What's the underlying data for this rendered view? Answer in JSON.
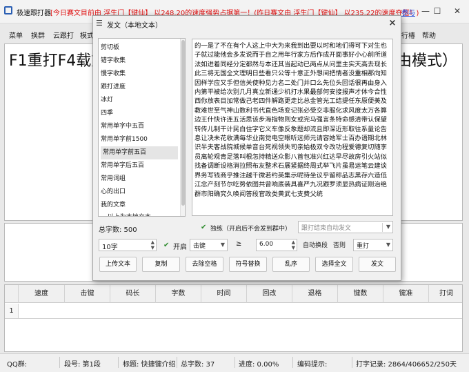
{
  "window": {
    "title": "极速跟打器",
    "notice": "[今日赛文目前由 浮生门【键仙】 以248.20的速度强势占据第一！(昨日赛文由 浮生门【键仙】 以235.22的速度夺冠！)",
    "link": "参与",
    "minimize": "—",
    "maximize": "☐",
    "close": "✕"
  },
  "menu": {
    "items": [
      "菜单",
      "换群",
      "云跟打",
      "模式"
    ],
    "right_items": [
      "行椿",
      "帮助"
    ]
  },
  "top_panel": {
    "text": "F1重打F4载文",
    "text_right": "由模式）"
  },
  "grid": {
    "columns": [
      "速度",
      "击键",
      "码长",
      "字数",
      "时间",
      "回改",
      "退格",
      "键数",
      "键准",
      "打词"
    ],
    "rows": [
      {
        "num": "1"
      }
    ]
  },
  "status": {
    "qq_group": "QQ群:",
    "segment": "段号: 第1段",
    "title": "标题: 快捷键介绍",
    "total": "总字数: 37",
    "progress": "进度: 0.00%",
    "code_hint": "编码提示:",
    "record": "打字记录: 2864/406652/250天"
  },
  "dialog": {
    "icon": "☰",
    "title": "发文（本地文本）",
    "close": "×",
    "list": [
      "剪切板",
      "错字收集",
      "慢字收集",
      "跟打进度",
      "冰灯",
      "四季",
      "常用单字中五百",
      "常用单字前1500",
      "常用单字前五百",
      "常用单字后五百",
      "常用词组",
      "心的出口",
      "我的文章",
      "---以上为本地文本---"
    ],
    "selected_index": 8,
    "article": "的一是了不在有个人这上中大为来我到出要以时和地们得可下对生也子就过能他会多发说而于自之用年行家方后作成开面事好小心前所道法如进着同经分定都然与本还其当起动已两点从问里主实天高去现长此三将无国全文理明日些看只公等十意正外想间把情者没重相那向知因样学应又手但信关使种见力名二处门并口么先位头回话很再由身入内第平被给次别几月真立新通少机打水果最部何安接报声才体今合性西你放表目加常做己老四件解路更走比总金管光工结提任东原便美及教难世至气神山数利书代直色场变记张必受交非服化求风度太万各算边王什快许连五活思该步海指物则女或完马强言条特命感清带认保望转传儿制干计民白住字它义车像反象题却流且即深近形取往系量论告息让决未花收满每华业南觉电空眼听远师元请容她军士百办语期北林识半夫客战院城候单音台死视领失司亲始极双令改功程爱德复切随李员离轮观青足落叫根怎持精送众影八首包准兴红达早尽故房引火站似找备调断设格消拉照布友整术石展紧据终周式举飞片虽易运笔云建谈界务写钱商乎推注越千微若约英集示呢待坐议乎留称品志黑存六造低江念产刻节尔吃势依图共曾响底装具喜严九况跟罗须显热病证刚治绝群市阳确究久唤闻答段官政类黄武七支费父统",
    "word_count": "总字数: 500",
    "separate_check": "✔",
    "separate_label": "独练（开启后不会发到群中）",
    "auto_send_placeholder": "跟打结束自动发文",
    "unit_value": "10字",
    "enable_check": "✔",
    "enable_label": "开启",
    "key_select": "击键",
    "gte": "≥",
    "value": "6.00",
    "auto_change": "自动换段",
    "else_label": "否则",
    "mode_select": "重打",
    "buttons": [
      "上传文本",
      "复制",
      "去除空格",
      "符号替换",
      "乱序",
      "选择全文",
      "发文"
    ]
  }
}
